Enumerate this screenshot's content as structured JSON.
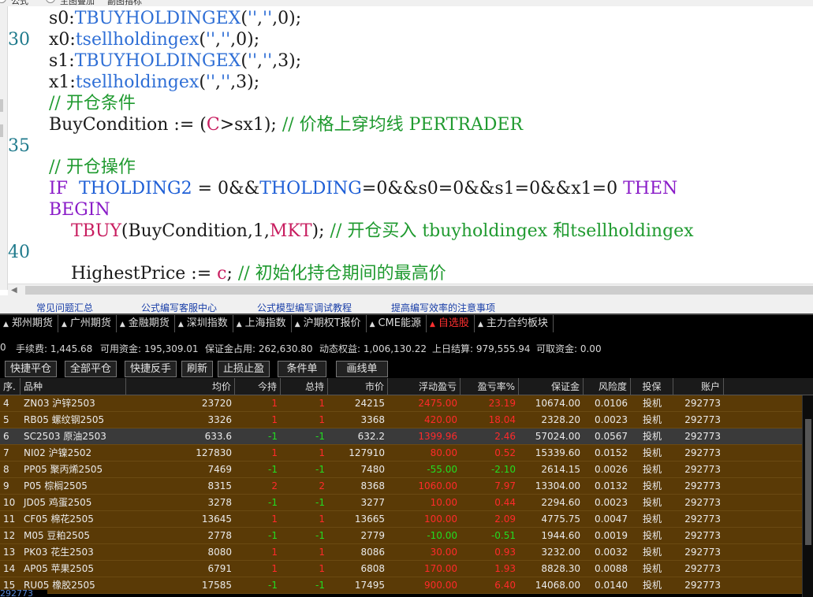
{
  "editor": {
    "top_tabs": [
      "公式",
      "主图叠加",
      "副图指标"
    ],
    "lines": [
      {
        "num": "",
        "parts": [
          [
            "s0:",
            ""
          ],
          [
            "TBUYHOLDINGEX",
            "fn"
          ],
          [
            "(",
            ""
          ],
          [
            "''",
            "str"
          ],
          [
            ",",
            ""
          ],
          [
            "''",
            "str"
          ],
          [
            ",0);",
            ""
          ]
        ]
      },
      {
        "num": "30",
        "parts": [
          [
            "x0:",
            ""
          ],
          [
            "tsellholdingex",
            "fn"
          ],
          [
            "(",
            ""
          ],
          [
            "''",
            "str"
          ],
          [
            ",",
            ""
          ],
          [
            "''",
            "str"
          ],
          [
            ",0);",
            ""
          ]
        ]
      },
      {
        "num": "",
        "parts": [
          [
            "s1:",
            ""
          ],
          [
            "TBUYHOLDINGEX",
            "fn"
          ],
          [
            "(",
            ""
          ],
          [
            "''",
            "str"
          ],
          [
            ",",
            ""
          ],
          [
            "''",
            "str"
          ],
          [
            ",3);",
            ""
          ]
        ]
      },
      {
        "num": "",
        "parts": [
          [
            "x1:",
            ""
          ],
          [
            "tsellholdingex",
            "fn"
          ],
          [
            "(",
            ""
          ],
          [
            "''",
            "str"
          ],
          [
            ",",
            ""
          ],
          [
            "''",
            "str"
          ],
          [
            ",3);",
            ""
          ]
        ]
      },
      {
        "num": "",
        "parts": [
          [
            "// 开仓条件",
            "cmt"
          ]
        ]
      },
      {
        "num": "",
        "parts": [
          [
            "BuyCondition := (",
            ""
          ],
          [
            "C",
            "red"
          ],
          [
            ">sx1); ",
            ""
          ],
          [
            "// 价格上穿均线 PERTRADER",
            "cmt"
          ]
        ]
      },
      {
        "num": "35",
        "parts": []
      },
      {
        "num": "",
        "parts": [
          [
            "// 开仓操作",
            "cmt"
          ]
        ]
      },
      {
        "num": "",
        "parts": [
          [
            "IF",
            "purple"
          ],
          [
            "  ",
            ""
          ],
          [
            "THOLDING2",
            "blue"
          ],
          [
            " = 0&&",
            ""
          ],
          [
            "THOLDING",
            "blue"
          ],
          [
            "=0&&s0=0&&s1=0&&x1=0 ",
            ""
          ],
          [
            "THEN",
            "purple"
          ]
        ]
      },
      {
        "num": "",
        "parts": [
          [
            "BEGIN",
            "purple"
          ]
        ]
      },
      {
        "num": "",
        "parts": [
          [
            "    ",
            ""
          ],
          [
            "TBUY",
            "red"
          ],
          [
            "(BuyCondition,1,",
            ""
          ],
          [
            "MKT",
            "red"
          ],
          [
            "); ",
            ""
          ],
          [
            "// 开仓买入 tbuyholdingex 和tsellholdingex",
            "cmt"
          ]
        ]
      },
      {
        "num": "40",
        "parts": []
      },
      {
        "num": "",
        "parts": [
          [
            "    HighestPrice := ",
            ""
          ],
          [
            "c",
            "red"
          ],
          [
            "; ",
            ""
          ],
          [
            "// 初始化持仓期间的最高价",
            "cmt"
          ]
        ]
      }
    ]
  },
  "links": [
    "常见问题汇总",
    "公式编写客服中心",
    "公式模型编写调试教程",
    "提高编写效率的注意事项"
  ],
  "tabs": [
    "郑州期货",
    "广州期货",
    "金融期货",
    "深圳指数",
    "上海指数",
    "沪期权T报价",
    "CME能源",
    "自选股",
    "主力合约板块"
  ],
  "active_tab": "自选股",
  "account": {
    "prefix": "0",
    "fee": "手续费: 1,445.68",
    "avail": "可用资金: 195,309.01",
    "margin": "保证金占用: 262,630.80",
    "dynamic": "动态权益: 1,006,130.22",
    "settle": "上日结算: 979,555.94",
    "withdraw": "可取资金: 0.00"
  },
  "buttons": [
    "快捷平仓",
    "全部平仓",
    "快捷反手",
    "刷新",
    "止损止盈",
    "条件单",
    "画线单"
  ],
  "table": {
    "headers": [
      "序.",
      "品种",
      "均价",
      "今持",
      "总持",
      "市价",
      "浮动盈亏",
      "盈亏率%",
      "保证金",
      "风险度",
      "投保",
      "账户"
    ],
    "rows": [
      {
        "idx": "4",
        "name": "ZN03 沪锌2503",
        "avg": "23720",
        "today": "1",
        "total": "1",
        "price": "24215",
        "pnl": "2475.00",
        "rate": "23.19",
        "margin": "10674.00",
        "risk": "0.0106",
        "hedge": "投机",
        "acct": "292773",
        "dir": "long",
        "sign": "pos"
      },
      {
        "idx": "5",
        "name": "RB05 螺纹钢2505",
        "avg": "3326",
        "today": "1",
        "total": "1",
        "price": "3368",
        "pnl": "420.00",
        "rate": "18.04",
        "margin": "2328.20",
        "risk": "0.0023",
        "hedge": "投机",
        "acct": "292773",
        "dir": "long",
        "sign": "pos"
      },
      {
        "idx": "6",
        "name": "SC2503 原油2503",
        "avg": "633.6",
        "today": "-1",
        "total": "-1",
        "price": "632.2",
        "pnl": "1399.96",
        "rate": "2.46",
        "margin": "57024.00",
        "risk": "0.0567",
        "hedge": "投机",
        "acct": "292773",
        "dir": "short",
        "sign": "pos",
        "sel": true
      },
      {
        "idx": "7",
        "name": "NI02 沪镍2502",
        "avg": "127830",
        "today": "1",
        "total": "1",
        "price": "127910",
        "pnl": "80.00",
        "rate": "0.52",
        "margin": "15339.60",
        "risk": "0.0152",
        "hedge": "投机",
        "acct": "292773",
        "dir": "long",
        "sign": "pos"
      },
      {
        "idx": "8",
        "name": "PP05 聚丙烯2505",
        "avg": "7469",
        "today": "-1",
        "total": "-1",
        "price": "7480",
        "pnl": "-55.00",
        "rate": "-2.10",
        "margin": "2614.15",
        "risk": "0.0026",
        "hedge": "投机",
        "acct": "292773",
        "dir": "short",
        "sign": "neg"
      },
      {
        "idx": "9",
        "name": "P05 棕榈2505",
        "avg": "8315",
        "today": "2",
        "total": "2",
        "price": "8368",
        "pnl": "1060.00",
        "rate": "7.97",
        "margin": "13304.00",
        "risk": "0.0132",
        "hedge": "投机",
        "acct": "292773",
        "dir": "long",
        "sign": "pos"
      },
      {
        "idx": "10",
        "name": "JD05 鸡蛋2505",
        "avg": "3278",
        "today": "-1",
        "total": "-1",
        "price": "3277",
        "pnl": "10.00",
        "rate": "0.44",
        "margin": "2294.60",
        "risk": "0.0023",
        "hedge": "投机",
        "acct": "292773",
        "dir": "short",
        "sign": "pos"
      },
      {
        "idx": "11",
        "name": "CF05 棉花2505",
        "avg": "13645",
        "today": "1",
        "total": "1",
        "price": "13665",
        "pnl": "100.00",
        "rate": "2.09",
        "margin": "4775.75",
        "risk": "0.0047",
        "hedge": "投机",
        "acct": "292773",
        "dir": "long",
        "sign": "pos"
      },
      {
        "idx": "12",
        "name": "M05 豆粕2505",
        "avg": "2778",
        "today": "-1",
        "total": "-1",
        "price": "2779",
        "pnl": "-10.00",
        "rate": "-0.51",
        "margin": "1944.60",
        "risk": "0.0019",
        "hedge": "投机",
        "acct": "292773",
        "dir": "short",
        "sign": "neg"
      },
      {
        "idx": "13",
        "name": "PK03 花生2503",
        "avg": "8080",
        "today": "1",
        "total": "1",
        "price": "8086",
        "pnl": "30.00",
        "rate": "0.93",
        "margin": "3232.00",
        "risk": "0.0032",
        "hedge": "投机",
        "acct": "292773",
        "dir": "long",
        "sign": "pos"
      },
      {
        "idx": "14",
        "name": "AP05 苹果2505",
        "avg": "6791",
        "today": "1",
        "total": "1",
        "price": "6808",
        "pnl": "170.00",
        "rate": "1.93",
        "margin": "8828.30",
        "risk": "0.0088",
        "hedge": "投机",
        "acct": "292773",
        "dir": "long",
        "sign": "pos"
      },
      {
        "idx": "15",
        "name": "RU05 橡胶2505",
        "avg": "17585",
        "today": "-1",
        "total": "-1",
        "price": "17495",
        "pnl": "900.00",
        "rate": "6.40",
        "margin": "14068.00",
        "risk": "0.0140",
        "hedge": "投机",
        "acct": "292773",
        "dir": "short",
        "sign": "pos"
      }
    ]
  },
  "footer_acct": "292773",
  "colors": {
    "up": "#ff2a2a",
    "down": "#22dd22",
    "row_bg": "#5a3a06",
    "selected_bg": "#3a3a3a",
    "comment": "#1f9a2f",
    "function": "#2f6fd6",
    "keyword": "#8a1cc8"
  }
}
